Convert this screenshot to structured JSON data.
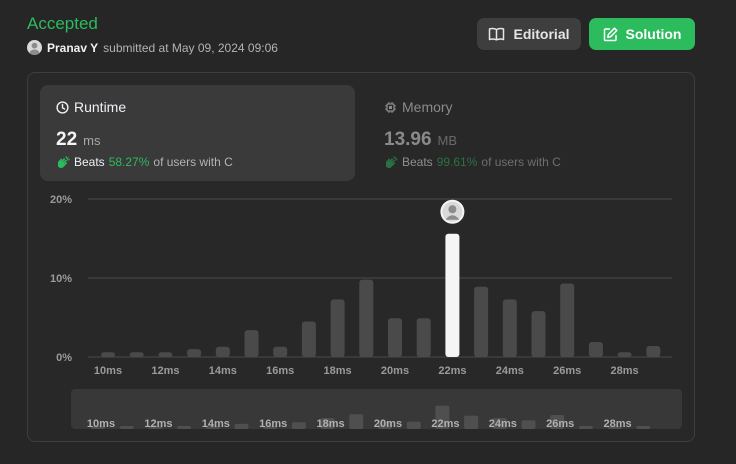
{
  "header": {
    "status": "Accepted",
    "username": "Pranav Y",
    "submitted_text": "submitted at May 09, 2024 09:06",
    "editorial_label": "Editorial",
    "solution_label": "Solution"
  },
  "runtime": {
    "title": "Runtime",
    "value": "22",
    "unit": "ms",
    "beats_word": "Beats",
    "beats_pct": "58.27%",
    "beats_suffix": "of users with C"
  },
  "memory": {
    "title": "Memory",
    "value": "13.96",
    "unit": "MB",
    "beats_word": "Beats",
    "beats_pct": "99.61%",
    "beats_suffix": "of users with C"
  },
  "colors": {
    "accepted": "#2cbb5d",
    "bar": "#4a4a4a",
    "bar_active": "#f5f5f5",
    "grid": "#4a4a4a"
  },
  "chart_data": {
    "type": "bar",
    "y_ticks": [
      "20%",
      "10%",
      "0%"
    ],
    "ylim": [
      0,
      20
    ],
    "x_ticks": [
      "10ms",
      "12ms",
      "14ms",
      "16ms",
      "18ms",
      "20ms",
      "22ms",
      "24ms",
      "26ms",
      "28ms"
    ],
    "bars": [
      {
        "x": 10,
        "value": 0.6
      },
      {
        "x": 11,
        "value": 0.6
      },
      {
        "x": 12,
        "value": 0.6
      },
      {
        "x": 13,
        "value": 1.0
      },
      {
        "x": 14,
        "value": 1.3
      },
      {
        "x": 15,
        "value": 3.4
      },
      {
        "x": 16,
        "value": 1.3
      },
      {
        "x": 17,
        "value": 4.5
      },
      {
        "x": 18,
        "value": 7.3
      },
      {
        "x": 19,
        "value": 9.8
      },
      {
        "x": 20,
        "value": 4.9
      },
      {
        "x": 21,
        "value": 4.9
      },
      {
        "x": 22,
        "value": 15.6,
        "selected": true
      },
      {
        "x": 23,
        "value": 8.9
      },
      {
        "x": 24,
        "value": 7.3
      },
      {
        "x": 25,
        "value": 5.8
      },
      {
        "x": 26,
        "value": 9.3
      },
      {
        "x": 27,
        "value": 1.9
      },
      {
        "x": 28,
        "value": 0.6
      },
      {
        "x": 29,
        "value": 1.4
      }
    ],
    "selected_x": 22
  }
}
